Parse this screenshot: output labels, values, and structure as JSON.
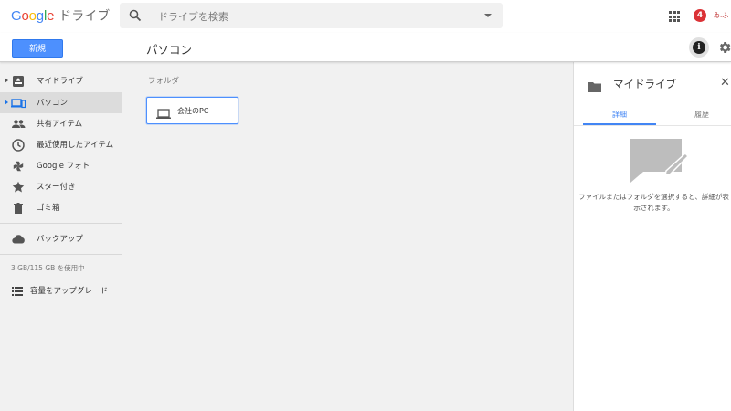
{
  "header": {
    "logo_word": "Google",
    "logo_product": "ドライブ",
    "search_placeholder": "ドライブを検索",
    "notification_count": "4",
    "avatar_text": "ゐ.ふ",
    "logo_colors": [
      "#4285f4",
      "#ea4335",
      "#fbbc05",
      "#4285f4",
      "#34a853",
      "#ea4335"
    ]
  },
  "toolbar": {
    "new_label": "新規",
    "page_title": "パソコン",
    "info_label": "i"
  },
  "sidebar": {
    "items": [
      {
        "label": "マイドライブ",
        "icon": "my-drive-icon",
        "expandable": true,
        "active": false
      },
      {
        "label": "パソコン",
        "icon": "computers-icon",
        "expandable": true,
        "active": true
      },
      {
        "label": "共有アイテム",
        "icon": "shared-people-icon",
        "expandable": false,
        "active": false
      },
      {
        "label": "最近使用したアイテム",
        "icon": "clock-icon",
        "expandable": false,
        "active": false
      },
      {
        "label": "Google フォト",
        "icon": "photos-pinwheel-icon",
        "expandable": false,
        "active": false
      },
      {
        "label": "スター付き",
        "icon": "star-icon",
        "expandable": false,
        "active": false
      },
      {
        "label": "ゴミ箱",
        "icon": "trash-icon",
        "expandable": false,
        "active": false
      }
    ],
    "backup_label": "バックアップ",
    "quota_text": "3 GB/115 GB を使用中",
    "upgrade_label": "容量をアップグレード"
  },
  "content": {
    "section_label": "フォルダ",
    "folders": [
      {
        "name": "会社のPC",
        "icon": "laptop-icon"
      }
    ]
  },
  "details_panel": {
    "title": "マイドライブ",
    "tabs": [
      "詳細",
      "履歴"
    ],
    "selected_tab": "詳細",
    "message": "ファイルまたはフォルダを選択すると、詳細が表示されます。",
    "accent_color": "#4285f4"
  },
  "colors": {
    "primary_button": "#4d90fe",
    "badge": "#db3236",
    "sidebar_active": "#dcdcdc",
    "background": "#f1f1f1"
  }
}
